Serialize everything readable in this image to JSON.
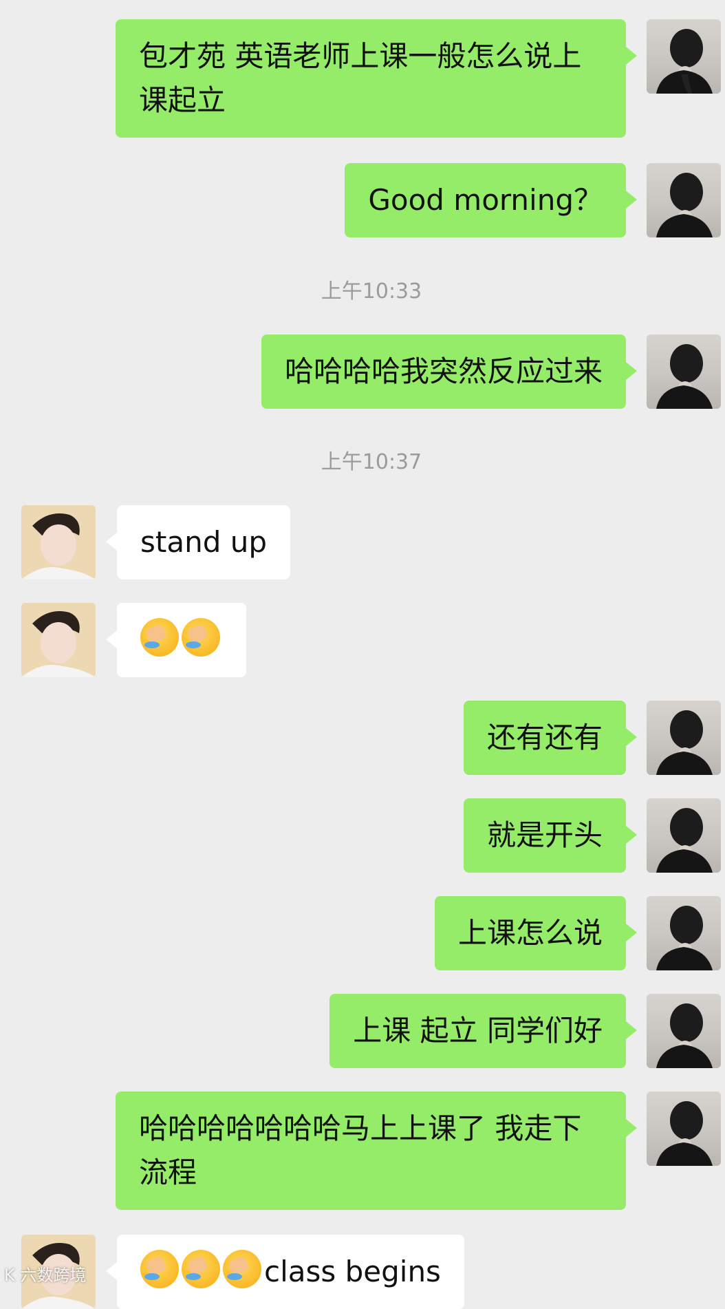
{
  "chat": {
    "messages": [
      {
        "side": "me",
        "text": "包才苑 英语老师上课一般怎么说上课起立"
      },
      {
        "side": "me",
        "text": "Good morning？"
      },
      {
        "type": "timestamp",
        "text": "上午10:33"
      },
      {
        "side": "me",
        "text": "哈哈哈哈我突然反应过来"
      },
      {
        "type": "timestamp",
        "text": "上午10:37"
      },
      {
        "side": "other",
        "text": "stand up"
      },
      {
        "side": "other",
        "emoji_count": 2,
        "emoji": "facepalm-crying-emoji"
      },
      {
        "side": "me",
        "text": "还有还有"
      },
      {
        "side": "me",
        "text": "就是开头"
      },
      {
        "side": "me",
        "text": "上课怎么说"
      },
      {
        "side": "me",
        "text": "上课 起立 同学们好"
      },
      {
        "side": "me",
        "text": "哈哈哈哈哈哈哈马上上课了 我走下流程"
      },
      {
        "side": "other",
        "emoji_count": 3,
        "emoji": "facepalm-crying-emoji",
        "text": "class begins"
      }
    ]
  },
  "watermark": {
    "text": "K 六数跨境"
  },
  "colors": {
    "me_bubble": "#95ec69",
    "other_bubble": "#ffffff",
    "background": "#ededed",
    "timestamp": "#9b9b9b"
  }
}
